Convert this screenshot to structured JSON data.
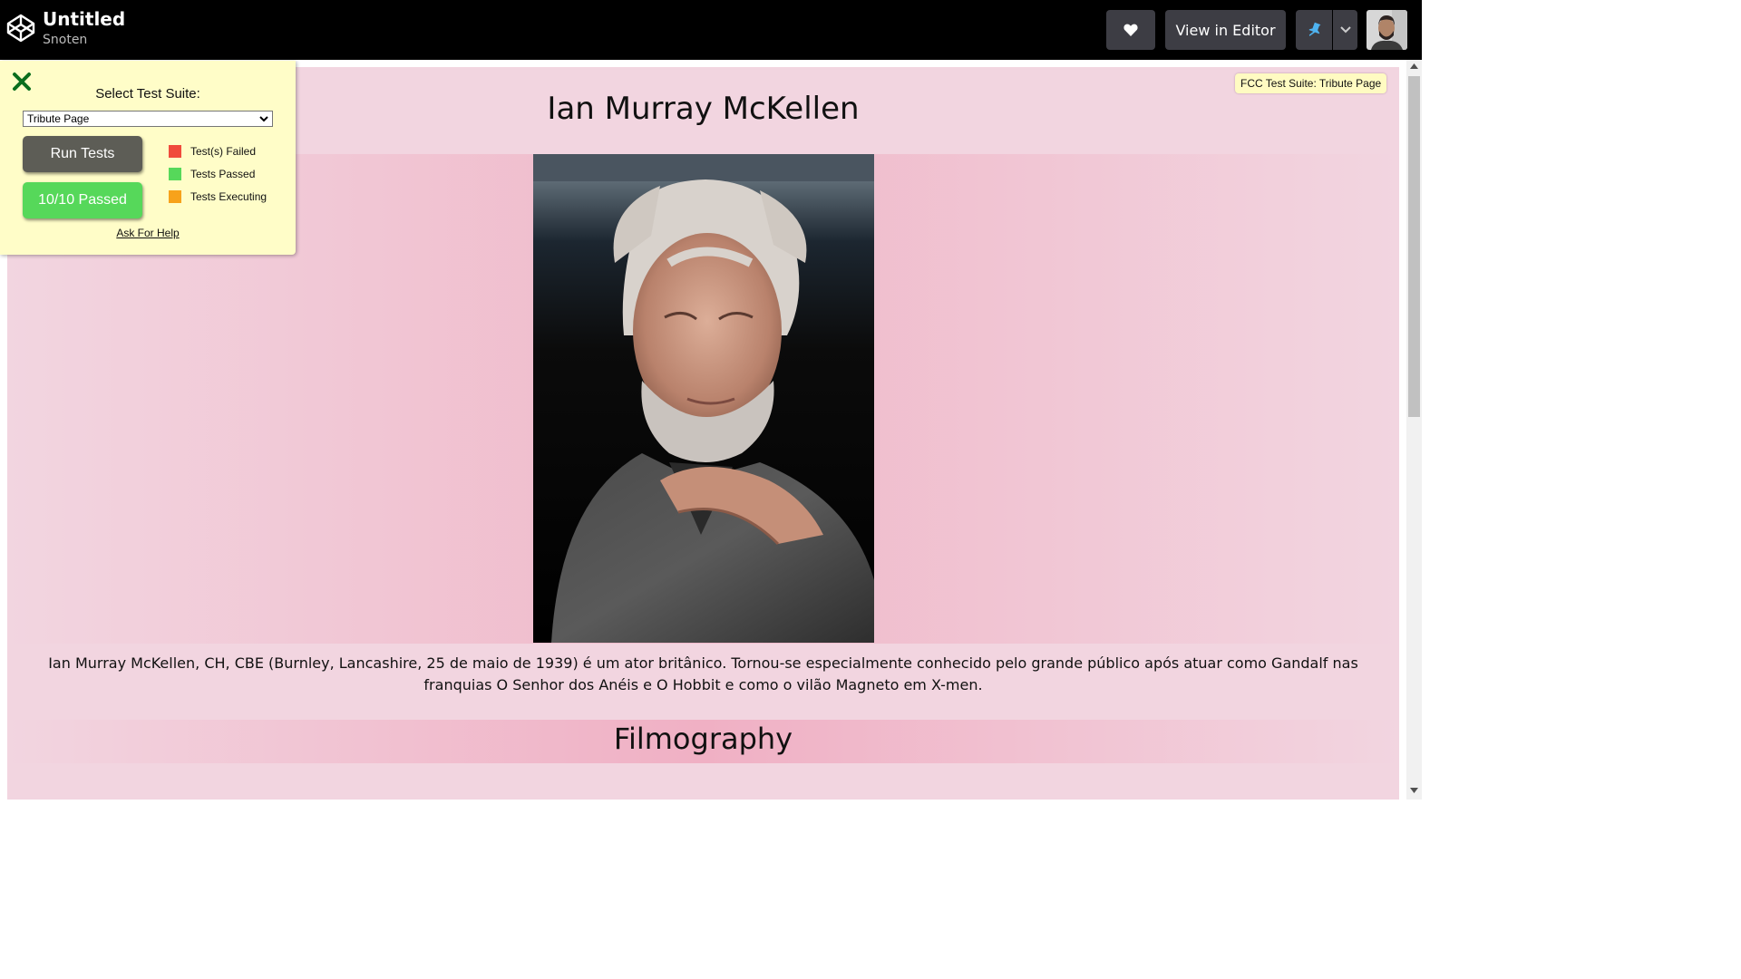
{
  "header": {
    "title": "Untitled",
    "author": "Snoten",
    "view_in_editor": "View in Editor"
  },
  "page": {
    "title": "Ian Murray McKellen",
    "bio": "Ian Murray McKellen, CH, CBE (Burnley, Lancashire, 25 de maio de 1939) é um ator britânico. Tornou-se especialmente conhecido pelo grande público após atuar como Gandalf nas franquias O Senhor dos Anéis e O Hobbit e como o vilão Magneto em X-men.",
    "filmography_title": "Filmography",
    "fcc_badge": "FCC Test Suite: Tribute Page"
  },
  "test_panel": {
    "select_label": "Select Test Suite:",
    "selected_suite": "Tribute Page",
    "run_button": "Run Tests",
    "result_button": "10/10 Passed",
    "legend": [
      {
        "label": "Test(s) Failed",
        "color": "#f04b3c"
      },
      {
        "label": "Tests Passed",
        "color": "#56d85a"
      },
      {
        "label": "Tests Executing",
        "color": "#f7a21b"
      }
    ],
    "help_link": "Ask For Help"
  },
  "colors": {
    "topbar": "#000000",
    "page_background": "#f2d5e0",
    "panel_background": "#fffdc8"
  }
}
